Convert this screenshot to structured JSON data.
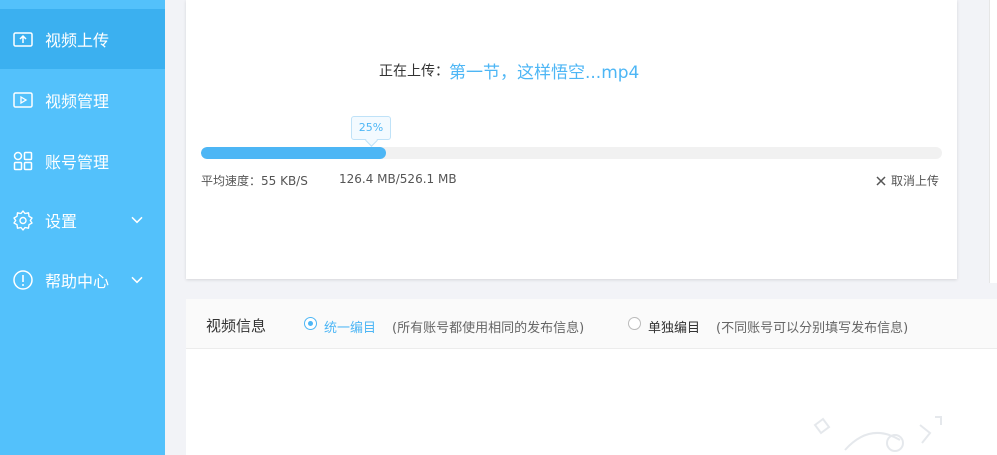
{
  "sidebar": {
    "items": [
      {
        "label": "视频上传",
        "icon": "video-upload-icon",
        "active": true
      },
      {
        "label": "视频管理",
        "icon": "video-manage-icon"
      },
      {
        "label": "账号管理",
        "icon": "account-grid-icon"
      },
      {
        "label": "设置",
        "icon": "gear-icon",
        "expandable": true
      },
      {
        "label": "帮助中心",
        "icon": "info-circle-icon",
        "expandable": true
      }
    ]
  },
  "upload": {
    "prefix": "正在上传：",
    "filename": "第一节，这样悟空...mp4",
    "percent_label": "25%",
    "progress": 0.25,
    "speed": "平均速度：55 KB/S",
    "size": "126.4 MB/526.1 MB",
    "cancel_label": "取消上传"
  },
  "video_info": {
    "title": "视频信息",
    "options": [
      {
        "label": "统一编目",
        "desc": "(所有账号都使用相同的发布信息)",
        "checked": true
      },
      {
        "label": "单独编目",
        "desc": "(不同账号可以分别填写发布信息)",
        "checked": false
      }
    ]
  },
  "colors": {
    "accent": "#4db6f5",
    "sidebar": "#53c1fb",
    "sidebar_active": "#3bb0f0"
  }
}
